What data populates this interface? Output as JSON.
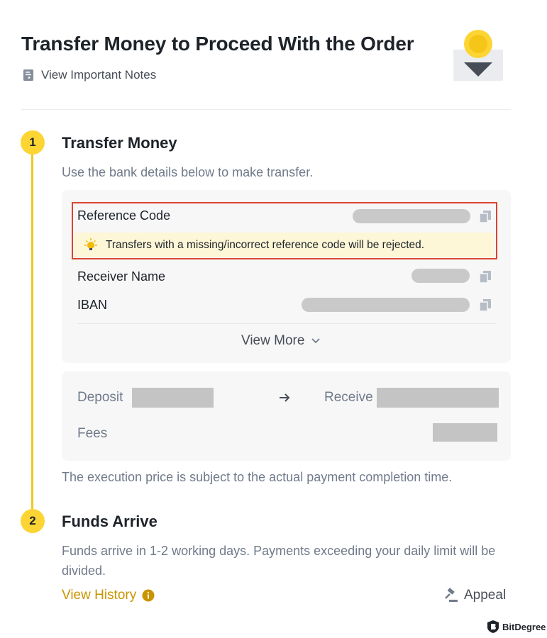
{
  "header": {
    "title": "Transfer Money to Proceed With the Order",
    "notes_link": "View Important Notes"
  },
  "steps": [
    {
      "number": "1",
      "title": "Transfer Money",
      "description": "Use the bank details below to make transfer."
    },
    {
      "number": "2",
      "title": "Funds Arrive",
      "description": "Funds arrive in 1-2 working days. Payments exceeding your daily limit will be divided."
    }
  ],
  "bank_details": {
    "reference_label": "Reference Code",
    "warning": "Transfers with a missing/incorrect reference code will be rejected.",
    "receiver_label": "Receiver Name",
    "iban_label": "IBAN",
    "view_more": "View More"
  },
  "summary": {
    "deposit_label": "Deposit",
    "receive_label": "Receive",
    "fees_label": "Fees"
  },
  "execution_note": "The execution price is subject to the actual payment completion time.",
  "footer": {
    "view_history": "View History",
    "appeal": "Appeal"
  },
  "watermark": "BitDegree",
  "colors": {
    "accent_yellow": "#fcd535",
    "link_gold": "#c99400",
    "highlight_red": "#d9452f",
    "warning_bg": "#fdf6d7",
    "card_bg": "#f7f7f8"
  },
  "icons": [
    "notes-icon",
    "bulb-icon",
    "copy-icon",
    "chevron-down-icon",
    "arrow-right-icon",
    "info-icon",
    "gavel-icon",
    "bitdegree-logo-icon"
  ]
}
